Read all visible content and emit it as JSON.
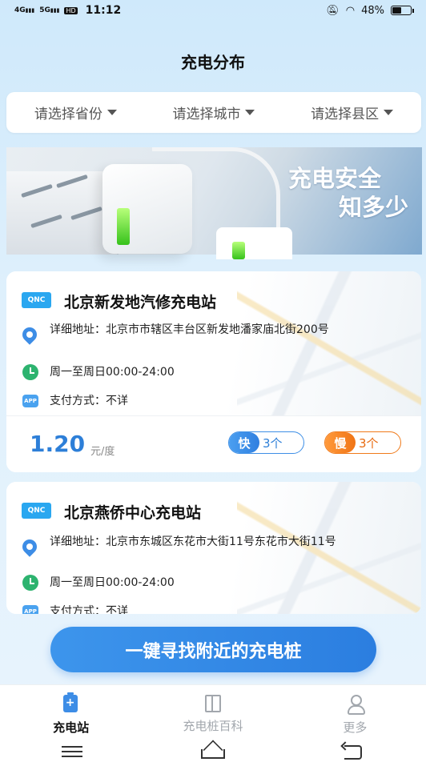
{
  "status_bar": {
    "network_1": "4G",
    "network_2": "5G",
    "hd_label": "HD",
    "time": "11:12",
    "battery": "48%",
    "battery_level": 0.48
  },
  "header": {
    "title": "充电分布"
  },
  "region_filter": {
    "province": "请选择省份",
    "city": "请选择城市",
    "county": "请选择县区"
  },
  "banner": {
    "line1": "充电安全",
    "line2": "知多少"
  },
  "stations": [
    {
      "badge": "QNC",
      "name": "北京新发地汽修充电站",
      "address": "详细地址：北京市市辖区丰台区新发地潘家庙北街200号",
      "hours": "周一至周日00:00-24:00",
      "payment": "支付方式：不详",
      "price": "1.20",
      "unit": "元/度",
      "fast_label": "快",
      "fast_count": "3个",
      "slow_label": "慢",
      "slow_count": "3个"
    },
    {
      "badge": "QNC",
      "name": "北京燕侨中心充电站",
      "address": "详细地址：北京市东城区东花市大街11号东花市大街11号",
      "hours": "周一至周日00:00-24:00",
      "payment": "支付方式：不详"
    }
  ],
  "cta": {
    "label": "一键寻找附近的充电桩"
  },
  "tabs": [
    {
      "label": "充电站",
      "icon": "charging-station-icon",
      "active": true
    },
    {
      "label": "充电桩百科",
      "icon": "book-icon",
      "active": false
    },
    {
      "label": "更多",
      "icon": "user-icon",
      "active": false
    }
  ],
  "app_icon_text": "APP",
  "colors": {
    "accent": "#2d7fd8",
    "fast": "#3e8fe6",
    "slow": "#f07a1a",
    "badge": "#2aa7f0"
  }
}
